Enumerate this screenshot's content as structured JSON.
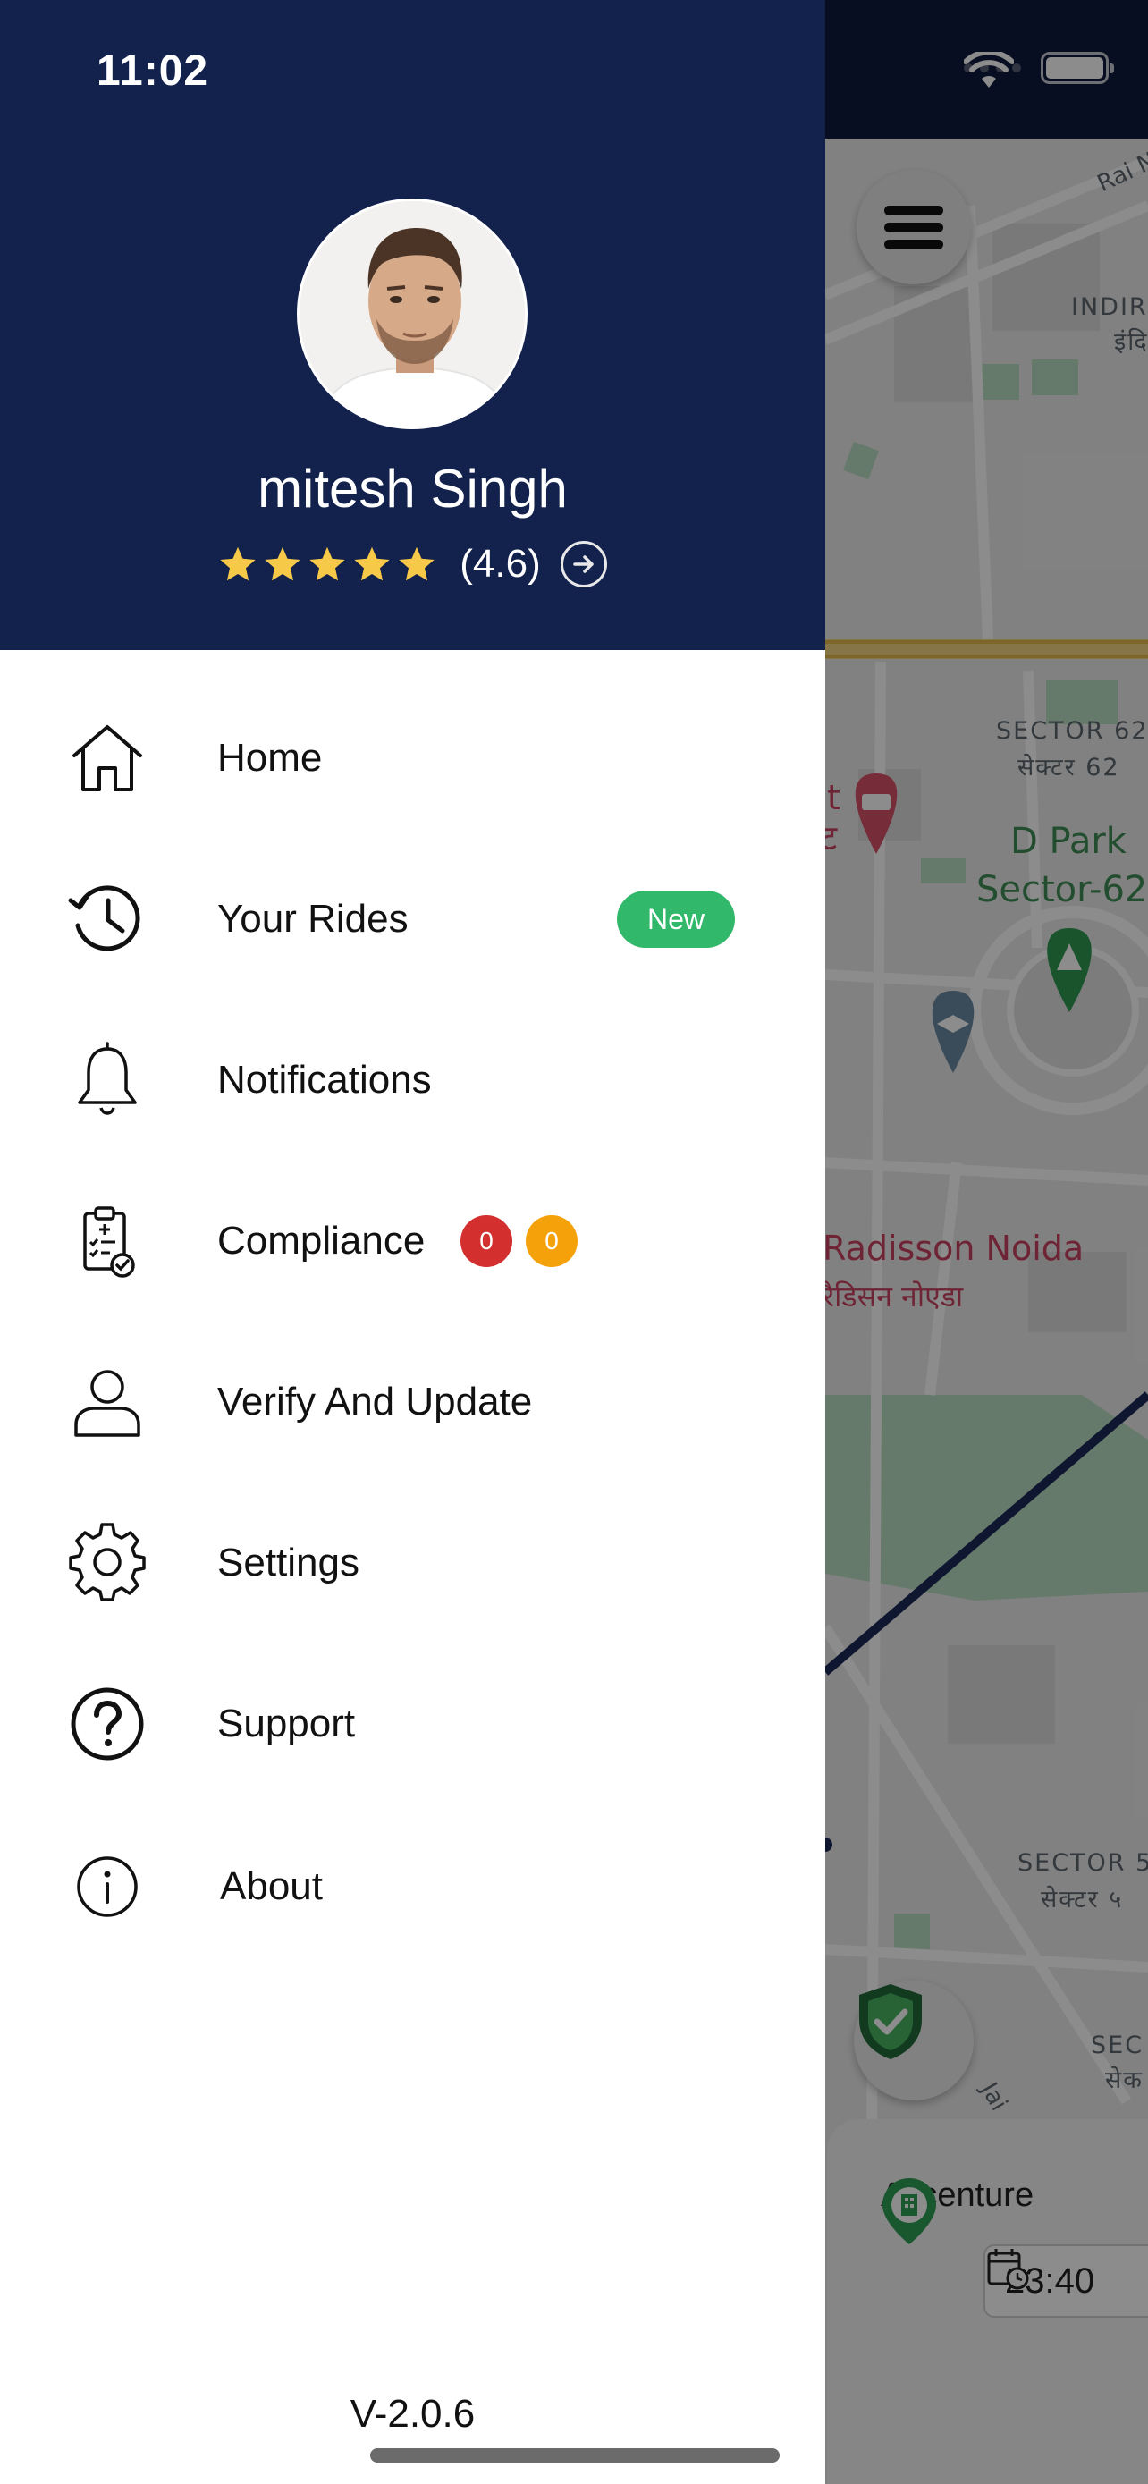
{
  "status_bar": {
    "time": "11:02"
  },
  "profile": {
    "name": "mitesh Singh",
    "rating_text": "(4.6)",
    "rating": 4.6,
    "stars_shown": 5
  },
  "menu": {
    "items": [
      {
        "id": "home",
        "label": "Home",
        "icon": "home-icon"
      },
      {
        "id": "rides",
        "label": "Your Rides",
        "icon": "history-clock-icon",
        "badge": "New"
      },
      {
        "id": "notifications",
        "label": "Notifications",
        "icon": "bell-icon"
      },
      {
        "id": "compliance",
        "label": "Compliance",
        "icon": "clipboard-check-icon",
        "counts": [
          "0",
          "0"
        ]
      },
      {
        "id": "verify",
        "label": "Verify And Update",
        "icon": "user-icon"
      },
      {
        "id": "settings",
        "label": "Settings",
        "icon": "gear-icon"
      },
      {
        "id": "support",
        "label": "Support",
        "icon": "question-circle-icon"
      },
      {
        "id": "about",
        "label": "About",
        "icon": "info-circle-icon"
      }
    ]
  },
  "version": "V-2.0.6",
  "map": {
    "labels": {
      "road_top": "Rai N",
      "indira_en": "INDIR",
      "indira_hi": "इंदि",
      "sector62_en": "SECTOR 62",
      "sector62_hi": "सेक्टर 62",
      "park_1": "D Park",
      "park_2": "Sector-62",
      "hotel_en": "Radisson Noida",
      "hotel_hi": "रैडिसन नोएडा",
      "sector_low_en": "SECTOR 5",
      "sector_low_hi": "सेक्टर ५",
      "sector_bottom_en": "SEC",
      "sector_bottom_hi": "सेक",
      "road_jai": "Jai",
      "cut_edge_1": "t",
      "cut_edge_2": "ट"
    }
  },
  "trip": {
    "destination": "Accenture",
    "time": "23:40"
  },
  "colors": {
    "header_bg": "#13214d",
    "badge_new": "#32b86a",
    "badge_red": "#d32f2f",
    "badge_orange": "#f5a10a",
    "star": "#f7c948"
  }
}
